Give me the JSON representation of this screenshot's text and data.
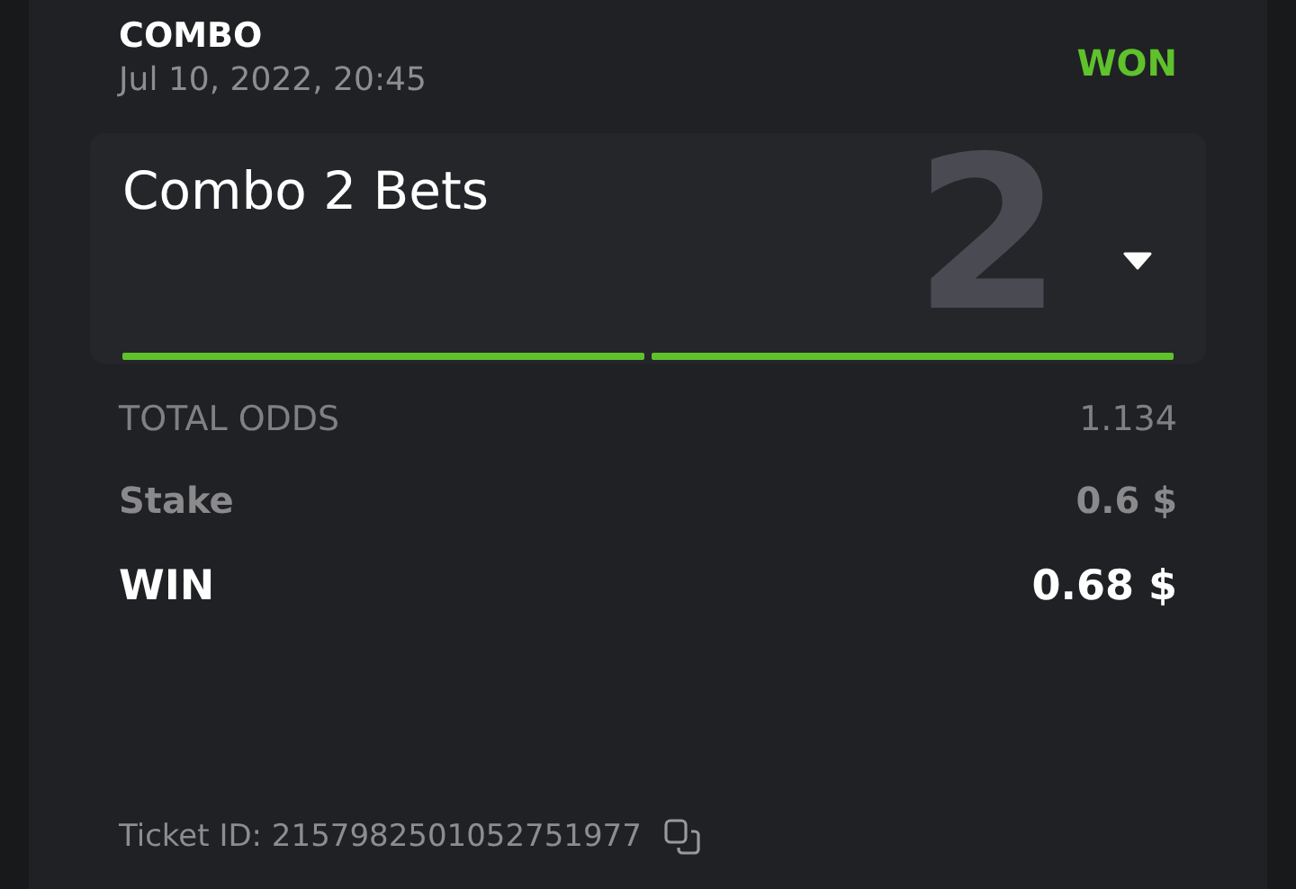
{
  "header": {
    "type": "COMBO",
    "date": "Jul 10, 2022, 20:45",
    "status": {
      "label": "WON",
      "kind": "won"
    }
  },
  "combo": {
    "title": "Combo 2 Bets",
    "count": "2",
    "expanded": false,
    "legs": [
      {
        "kind": "won"
      },
      {
        "kind": "won"
      }
    ]
  },
  "summary": [
    {
      "kind": "odds",
      "label": "TOTAL ODDS",
      "value": "1.134"
    },
    {
      "kind": "stake",
      "label": "Stake",
      "value": "0.6 $"
    },
    {
      "kind": "win",
      "label": "WIN",
      "value": "0.68 $"
    }
  ],
  "ticket": {
    "label": "Ticket ID: 2157982501052751977"
  }
}
